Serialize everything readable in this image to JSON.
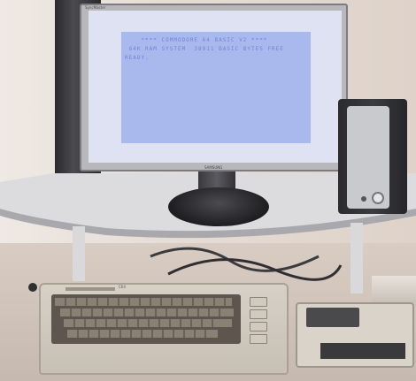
{
  "scene": {
    "description_colors": {
      "wall": "#e6ddd6",
      "screen_bg": "#a9b9ee",
      "screen_text": "#6f84d8",
      "monitor_frame": "#b8b8bc",
      "desk": "#cfc3ba"
    },
    "monitor": {
      "brand_bottom": "SAMSUNG",
      "brand_top": "SyncMaster"
    },
    "c64_screen_lines": [
      "    **** COMMODORE 64 BASIC V2 ****",
      " 64K RAM SYSTEM  38911 BASIC BYTES FREE",
      "READY."
    ],
    "c64": {
      "badge": "commodore 64",
      "label": "C64"
    }
  }
}
